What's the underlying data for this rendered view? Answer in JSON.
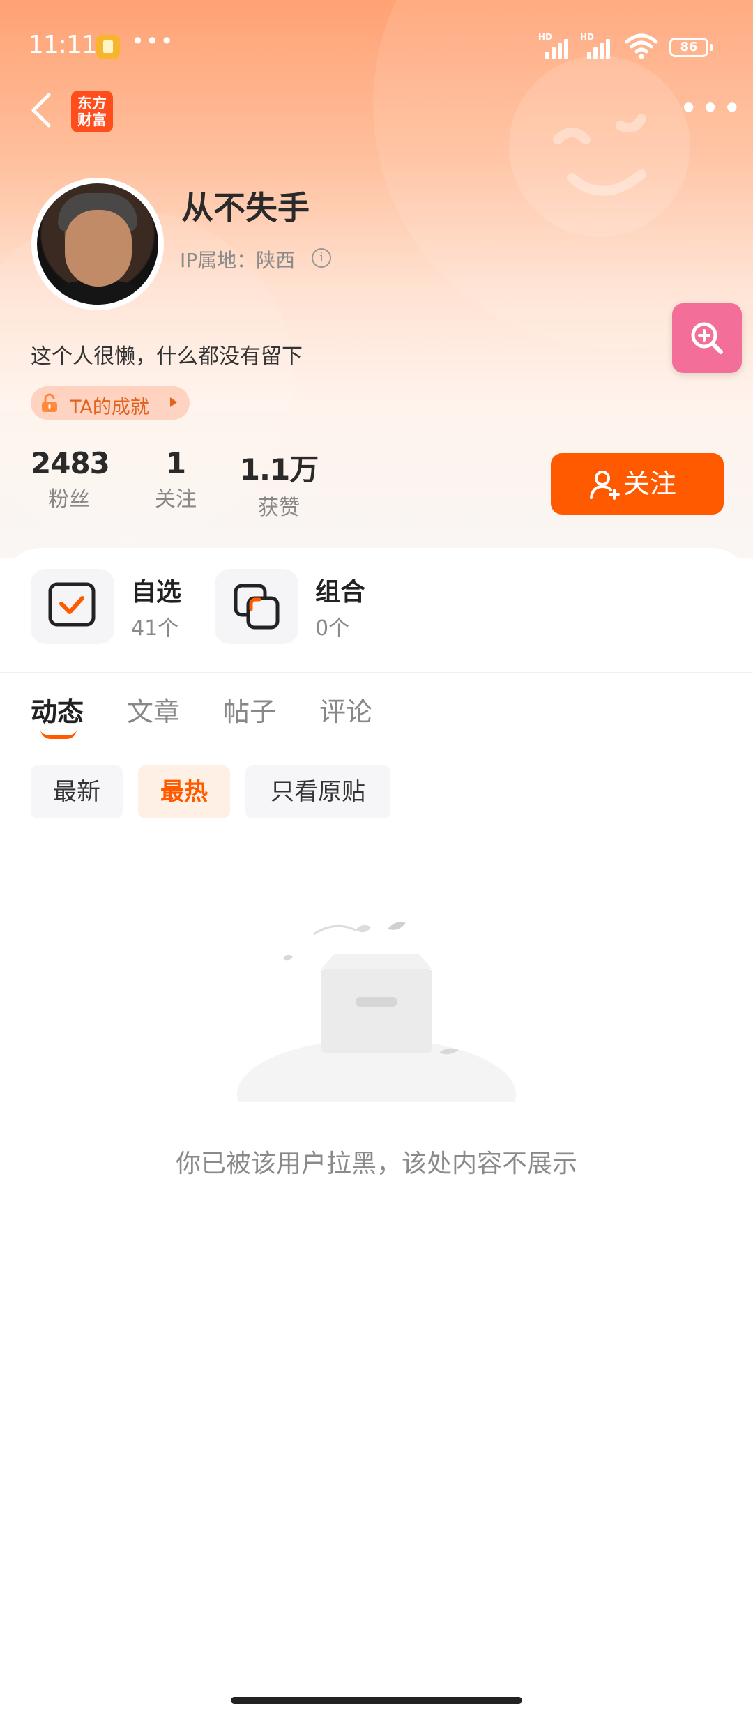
{
  "status_bar": {
    "time": "11:11",
    "battery": "86",
    "signal_label": "HD"
  },
  "nav": {
    "logo_line1": "东方",
    "logo_line2": "财富"
  },
  "profile": {
    "username": "从不失手",
    "ip_location": "IP属地：陕西",
    "bio": "这个人很懒，什么都没有留下",
    "achievement": "TA的成就"
  },
  "stats": [
    {
      "value": "2483",
      "label": "粉丝"
    },
    {
      "value": "1",
      "label": "关注"
    },
    {
      "value": "1.1万",
      "label": "获赞"
    }
  ],
  "follow_button": "关注",
  "shortcuts": [
    {
      "title": "自选",
      "count": "41个"
    },
    {
      "title": "组合",
      "count": "0个"
    }
  ],
  "tabs": [
    "动态",
    "文章",
    "帖子",
    "评论"
  ],
  "active_tab": "动态",
  "filters": [
    "最新",
    "最热",
    "只看原贴"
  ],
  "active_filter": "最热",
  "empty_message": "你已被该用户拉黑，该处内容不展示",
  "colors": {
    "accent": "#ff5a00",
    "hero_top": "#ffa274",
    "search_fab": "#f36f9a",
    "logo": "#ff4d1c"
  }
}
